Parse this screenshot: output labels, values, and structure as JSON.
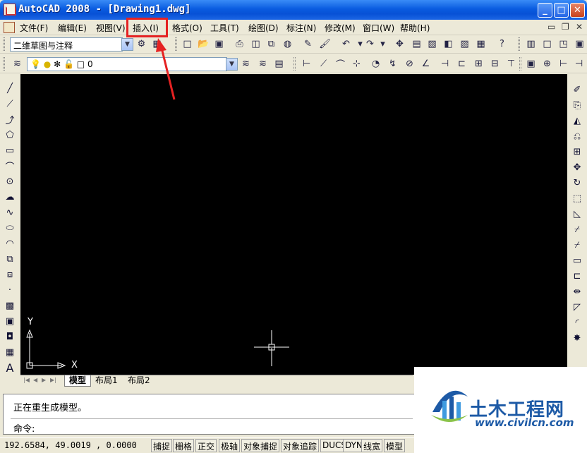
{
  "window": {
    "title": "AutoCAD 2008 - [Drawing1.dwg]",
    "minimize_label": "_",
    "maximize_label": "□",
    "close_label": "✕"
  },
  "menu": {
    "items": [
      "文件(F)",
      "编辑(E)",
      "视图(V)",
      "插入(I)",
      "格式(O)",
      "工具(T)",
      "绘图(D)",
      "标注(N)",
      "修改(M)",
      "窗口(W)",
      "帮助(H)"
    ],
    "highlighted": "插入(I)",
    "mdi_minimize": "▭",
    "mdi_restore": "❐",
    "mdi_close": "✕"
  },
  "toolbar": {
    "workspace": "二维草图与注释",
    "layer": "0"
  },
  "tabs": {
    "items": [
      "模型",
      "布局1",
      "布局2"
    ],
    "active": "模型"
  },
  "axes": {
    "x_label": "X",
    "y_label": "Y"
  },
  "command": {
    "history": "正在重生成模型。",
    "prompt": "命令:"
  },
  "status": {
    "coordinates": "192.6584, 49.0019 , 0.0000",
    "buttons": [
      "捕捉",
      "栅格",
      "正交",
      "极轴",
      "对象捕捉",
      "对象追踪",
      "DUCS",
      "DYN",
      "线宽",
      "模型"
    ]
  },
  "watermark": {
    "name": "土木工程网",
    "url": "www.civilcn.com"
  },
  "icons": {
    "toolbar_row1": [
      "workspace-settings-icon",
      "workspace-icon",
      "new-icon",
      "open-icon",
      "save-icon",
      "print-icon",
      "print-preview-icon",
      "publish-icon",
      "3d-publish-icon",
      "cut-icon",
      "match-properties-icon",
      "undo-icon",
      "redo-icon",
      "pan-icon",
      "properties-icon",
      "design-center-icon",
      "tool-palettes-icon",
      "sheet-set-icon",
      "markup-icon",
      "calculator-icon",
      "help-icon"
    ],
    "draw_toolbar": [
      "line-icon",
      "construction-line-icon",
      "polyline-icon",
      "polygon-icon",
      "rectangle-icon",
      "arc-icon",
      "circle-icon",
      "revision-cloud-icon",
      "spline-icon",
      "ellipse-icon",
      "ellipse-arc-icon",
      "insert-block-icon",
      "make-block-icon",
      "point-icon",
      "hatch-icon",
      "gradient-icon",
      "region-icon",
      "table-icon",
      "multiline-text-icon"
    ],
    "modify_toolbar": [
      "erase-icon",
      "copy-icon",
      "mirror-icon",
      "offset-icon",
      "array-icon",
      "move-icon",
      "rotate-icon",
      "scale-icon",
      "stretch-icon",
      "trim-icon",
      "extend-icon",
      "break-at-point-icon",
      "break-icon",
      "join-icon",
      "chamfer-icon",
      "fillet-icon",
      "explode-icon"
    ]
  }
}
